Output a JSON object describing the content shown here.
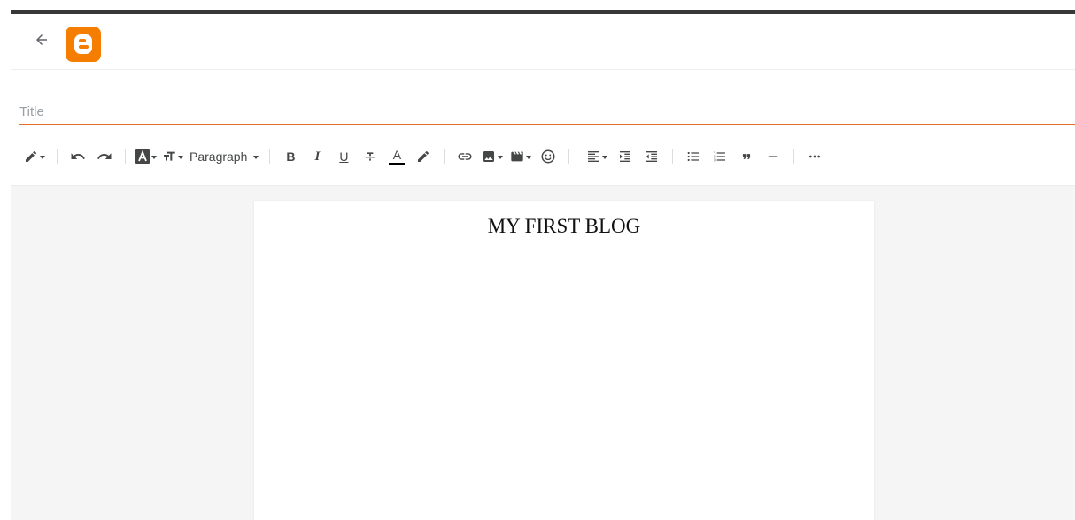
{
  "header": {
    "back_icon": "arrow-left-icon",
    "logo_icon": "blogger-logo-icon",
    "logo_color": "#f57d00"
  },
  "title_field": {
    "placeholder": "Title",
    "value": "",
    "underline_color": "#e06e2a"
  },
  "toolbar": {
    "paragraph_label": "Paragraph",
    "bold_label": "B",
    "italic_label": "I",
    "underline_label": "U",
    "text_color_label": "A",
    "icons": [
      "pencil-icon",
      "undo-icon",
      "redo-icon",
      "font-icon",
      "text-size-icon",
      "bold-icon",
      "italic-icon",
      "underline-icon",
      "strikethrough-icon",
      "text-color-icon",
      "highlight-icon",
      "link-icon",
      "image-icon",
      "video-icon",
      "emoji-icon",
      "align-icon",
      "indent-icon",
      "outdent-icon",
      "bulleted-list-icon",
      "numbered-list-icon",
      "quote-icon",
      "horizontal-rule-icon",
      "more-icon"
    ]
  },
  "document": {
    "heading": "MY FIRST BLOG"
  },
  "colors": {
    "top_strip": "#383838",
    "canvas_bg": "#f5f5f5"
  }
}
